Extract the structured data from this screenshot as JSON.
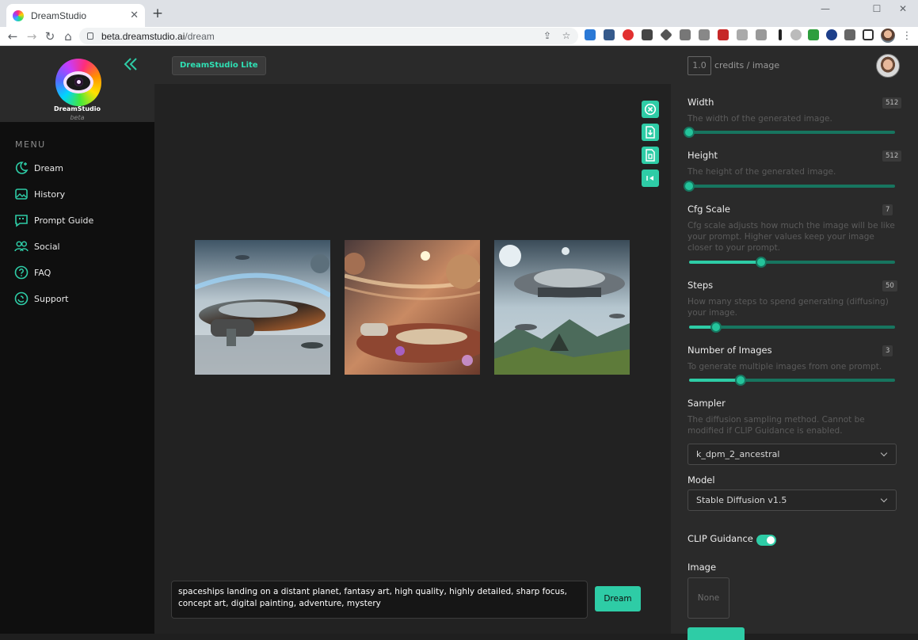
{
  "browser": {
    "tab_title": "DreamStudio",
    "tab_close": "✕",
    "new_tab": "+",
    "url_host": "beta.dreamstudio.ai",
    "url_path": "/dream",
    "window_minimize": "—",
    "window_maximize": "☐",
    "window_close": "✕",
    "back": "←",
    "forward": "→",
    "reload": "↻",
    "home": "⌂"
  },
  "brand": {
    "name": "DreamStudio",
    "tag": "beta"
  },
  "topbar": {
    "badge": "DreamStudio Lite",
    "credits_value": "1.0",
    "credits_label": "credits / image"
  },
  "menu": {
    "label": "MENU",
    "items": [
      {
        "label": "Dream",
        "icon": "moon-sparkle-icon"
      },
      {
        "label": "History",
        "icon": "image-stack-icon"
      },
      {
        "label": "Prompt Guide",
        "icon": "chat-quote-icon"
      },
      {
        "label": "Social",
        "icon": "people-icon"
      },
      {
        "label": "FAQ",
        "icon": "question-circle-icon"
      },
      {
        "label": "Support",
        "icon": "support-icon"
      }
    ]
  },
  "tools": [
    "close-circle-icon",
    "download-icon",
    "document-icon",
    "skip-back-icon"
  ],
  "images": [
    {
      "name": "generated-image-1",
      "scene": "saucer-over-city"
    },
    {
      "name": "generated-image-2",
      "scene": "saucers-under-planets"
    },
    {
      "name": "generated-image-3",
      "scene": "saucer-over-hills"
    }
  ],
  "prompt": {
    "text": "spaceships landing on a distant planet, fantasy art, high quality, highly detailed, sharp focus, concept art, digital painting, adventure, mystery",
    "button": "Dream"
  },
  "settings": {
    "width": {
      "label": "Width",
      "value": "512",
      "desc": "The width of the generated image.",
      "fraction": 0.0
    },
    "height": {
      "label": "Height",
      "value": "512",
      "desc": "The height of the generated image.",
      "fraction": 0.0
    },
    "cfg": {
      "label": "Cfg Scale",
      "value": "7",
      "desc": "Cfg scale adjusts how much the image will be like your prompt. Higher values keep your image closer to your prompt.",
      "fraction": 0.35
    },
    "steps": {
      "label": "Steps",
      "value": "50",
      "desc": "How many steps to spend generating (diffusing) your image.",
      "fraction": 0.13
    },
    "num_images": {
      "label": "Number of Images",
      "value": "3",
      "desc": "To generate multiple images from one prompt.",
      "fraction": 0.25
    },
    "sampler": {
      "label": "Sampler",
      "desc": "The diffusion sampling method. Cannot be modified if CLIP Guidance is enabled.",
      "value": "k_dpm_2_ancestral"
    },
    "model": {
      "label": "Model",
      "value": "Stable Diffusion v1.5"
    },
    "clip": {
      "label": "CLIP Guidance",
      "enabled": true
    },
    "image": {
      "label": "Image",
      "value": "None"
    }
  },
  "colors": {
    "accent": "#2ecca6",
    "sidebar": "#0f0f0f",
    "panel": "#2a2a2a",
    "canvas": "#222222"
  }
}
